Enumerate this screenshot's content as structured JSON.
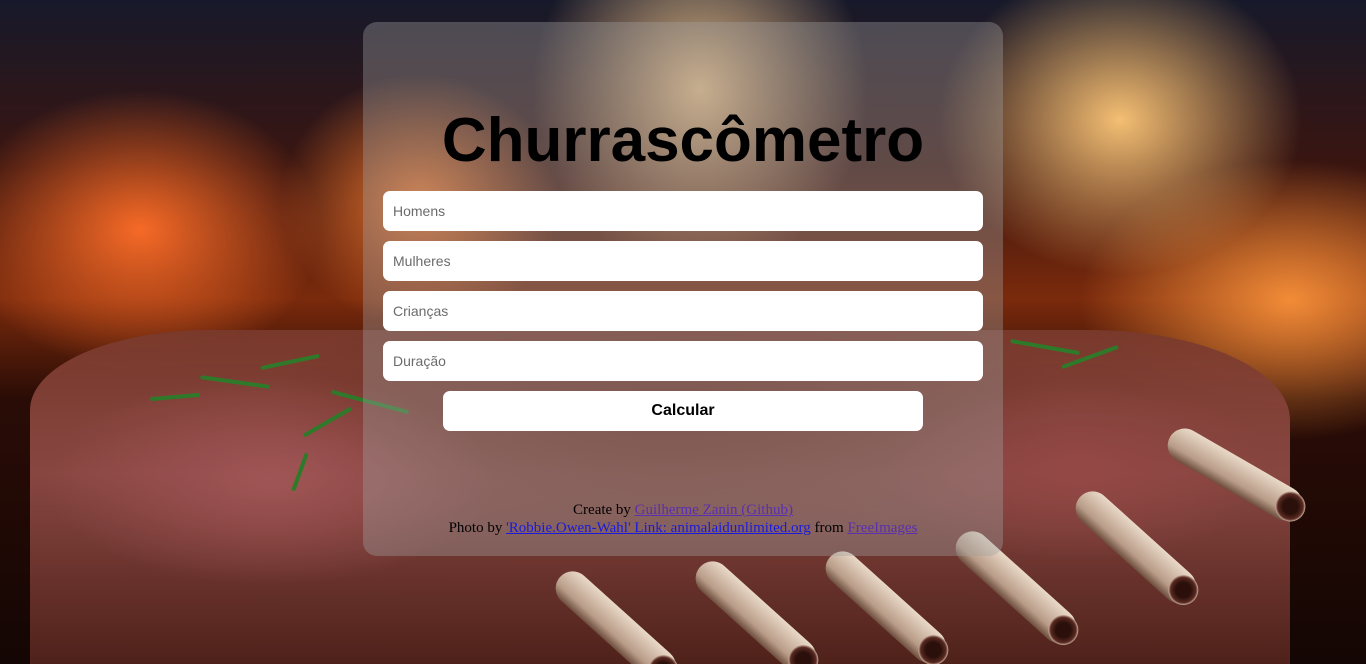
{
  "app": {
    "title": "Churrascômetro"
  },
  "form": {
    "fields": [
      {
        "name": "homens-input",
        "placeholder": "Homens"
      },
      {
        "name": "mulheres-input",
        "placeholder": "Mulheres"
      },
      {
        "name": "criancas-input",
        "placeholder": "Crianças"
      },
      {
        "name": "duracao-input",
        "placeholder": "Duração"
      }
    ],
    "submit_label": "Calcular"
  },
  "credits": {
    "line1_prefix": "Create by ",
    "author_link": "Guilherme Zanin (Github)",
    "line2_prefix": "Photo by ",
    "photo_link": "'Robbie.Owen-Wahl' Link: animalaidunlimited.org",
    "line2_mid": " from ",
    "source_link": "FreeImages"
  },
  "colors": {
    "card_background": "#a0a0a0",
    "visited_link": "#5a2fb0",
    "link": "#1a1add"
  }
}
